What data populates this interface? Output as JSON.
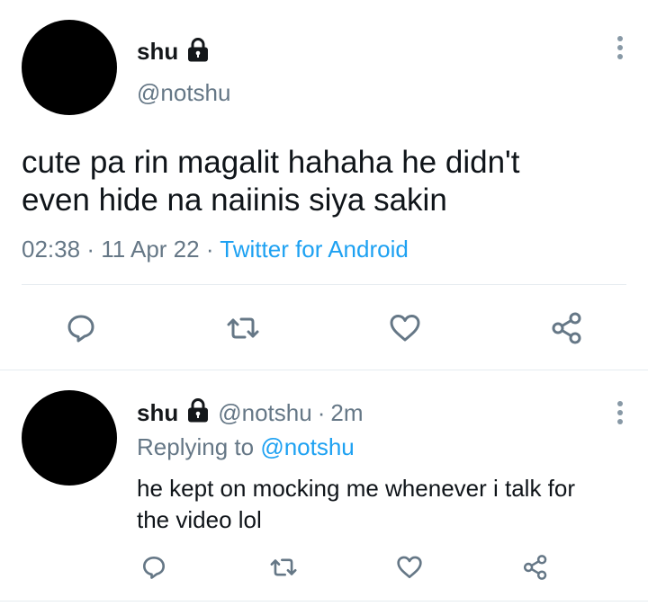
{
  "main_tweet": {
    "display_name": "shu",
    "username": "@notshu",
    "text_line1": "cute pa rin magalit hahaha he didn't",
    "text_line2": "even hide na naiinis siya sakin",
    "time": "02:38",
    "separator": "·",
    "date": "11 Apr 22",
    "source": "Twitter for Android",
    "icons": [
      "reply-icon",
      "retweet-icon",
      "like-icon",
      "share-icon"
    ]
  },
  "reply_tweet": {
    "display_name": "shu",
    "username": "@notshu",
    "separator": "·",
    "age": "2m",
    "replying_prefix": "Replying to",
    "replying_to": "@notshu",
    "text_line1": "he kept on mocking me whenever i talk for",
    "text_line2": "the video lol",
    "icons": [
      "reply-icon",
      "retweet-icon",
      "like-icon",
      "share-icon"
    ]
  },
  "colors": {
    "link": "#1da1f2",
    "muted": "#657786",
    "icon": "#657786",
    "divider": "#e6ecf0"
  }
}
